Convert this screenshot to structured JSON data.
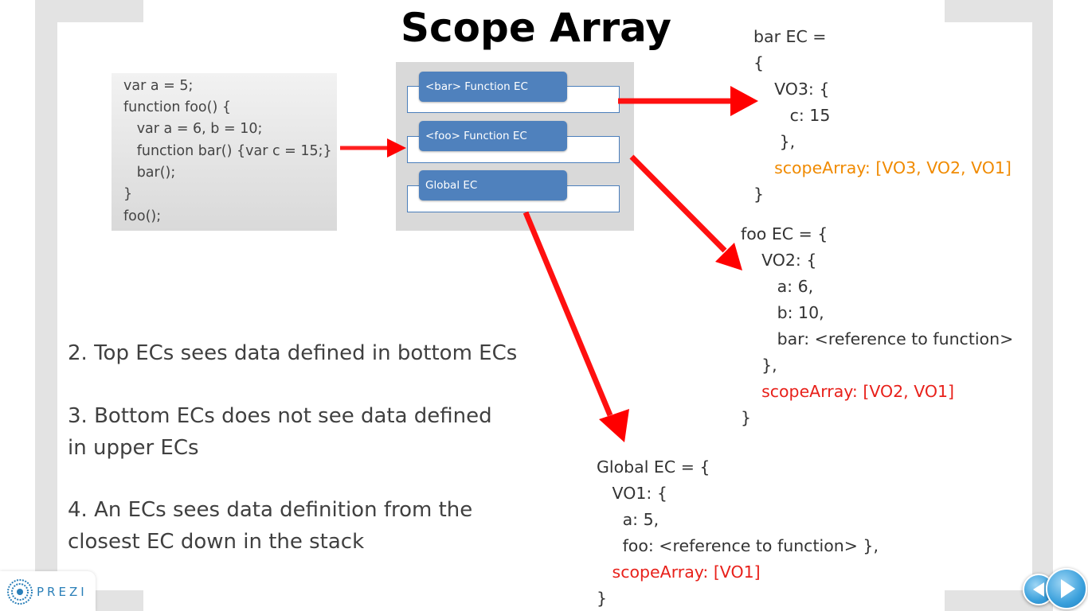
{
  "slide": {
    "title": "Scope Array"
  },
  "code": {
    "lines": [
      "var a = 5;",
      "function foo() {",
      "   var a = 6, b = 10;",
      "   function bar() {var c = 15;}",
      "   bar();",
      "}",
      "foo();"
    ]
  },
  "stack": {
    "items": [
      "<bar> Function EC",
      "<foo> Function EC",
      "Global EC"
    ]
  },
  "bar_ec": {
    "lines": [
      "bar EC =",
      "{",
      "    VO3: {",
      "       c: 15",
      "     },",
      "    scopeArray: [VO3, VO2, VO1]",
      "}"
    ],
    "highlight_color": "#f08a00"
  },
  "foo_ec": {
    "lines": [
      "foo EC = {",
      "    VO2: {",
      "       a: 6,",
      "       b: 10,",
      "       bar: <reference to function>",
      "    },",
      "    scopeArray: [VO2, VO1]",
      "}"
    ],
    "highlight_color": "#e8201a"
  },
  "global_ec": {
    "lines": [
      "Global EC = {",
      "   VO1: {",
      "     a: 5,",
      "     foo: <reference to function> },",
      "   scopeArray: [VO1]",
      "}"
    ],
    "highlight_color": "#e8201a"
  },
  "points": [
    "2. Top ECs sees data defined in bottom ECs",
    "3. Bottom ECs does not see data defined in upper ECs",
    "4. An ECs sees data definition from the closest EC down in the stack"
  ],
  "branding": {
    "logo_text": "PREZI",
    "logo_icon": "prezi-logo-icon"
  },
  "navigation": {
    "prev_icon": "arrow-left-icon",
    "next_icon": "arrow-right-icon"
  }
}
